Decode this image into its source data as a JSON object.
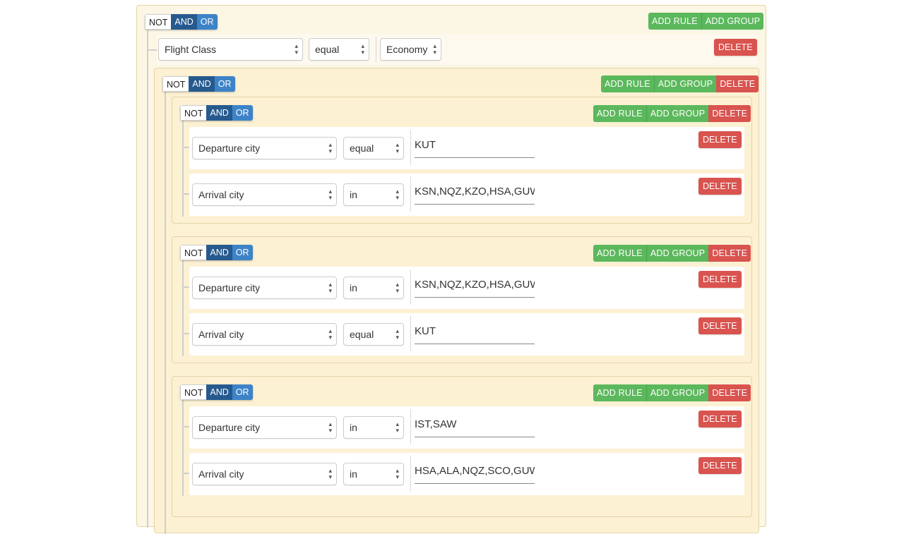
{
  "labels": {
    "not": "NOT",
    "and": "AND",
    "or": "OR",
    "add_rule": "ADD RULE",
    "add_group": "ADD GROUP",
    "delete": "DELETE"
  },
  "root": {
    "rule": {
      "field": "Flight Class",
      "operator": "equal",
      "value": "Economy"
    }
  },
  "groups": [
    {
      "rules": [
        {
          "field": "Departure city",
          "operator": "equal",
          "value": "KUT"
        },
        {
          "field": "Arrival city",
          "operator": "in",
          "value": "KSN,NQZ,KZO,HSA,GUW"
        }
      ]
    },
    {
      "rules": [
        {
          "field": "Departure city",
          "operator": "in",
          "value": "KSN,NQZ,KZO,HSA,GUW"
        },
        {
          "field": "Arrival city",
          "operator": "equal",
          "value": "KUT"
        }
      ]
    },
    {
      "rules": [
        {
          "field": "Departure city",
          "operator": "in",
          "value": "IST,SAW"
        },
        {
          "field": "Arrival city",
          "operator": "in",
          "value": "HSA,ALA,NQZ,SCO,GUW"
        }
      ]
    }
  ],
  "colors": {
    "and_active": "#265a8f",
    "or": "#3d83c7",
    "add": "#5cb85c",
    "delete": "#d9534f",
    "group_bg": "#fcf1d3"
  }
}
